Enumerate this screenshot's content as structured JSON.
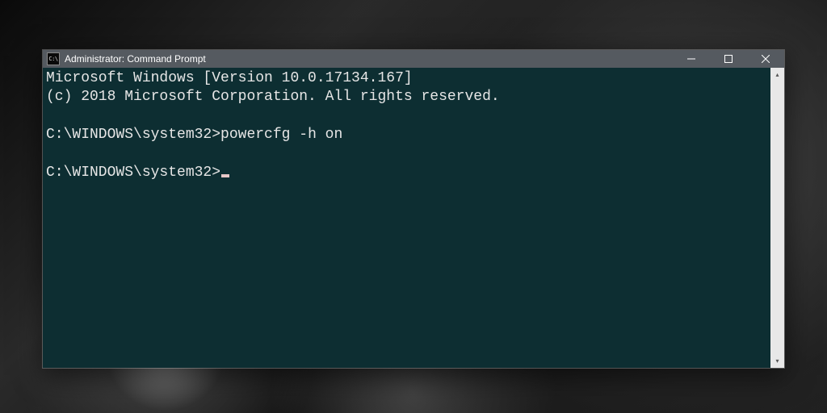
{
  "window": {
    "title": "Administrator: Command Prompt",
    "icon_label": "C:\\"
  },
  "console": {
    "banner1": "Microsoft Windows [Version 10.0.17134.167]",
    "banner2": "(c) 2018 Microsoft Corporation. All rights reserved.",
    "prompt1_path": "C:\\WINDOWS\\system32>",
    "prompt1_cmd": "powercfg -h on",
    "prompt2_path": "C:\\WINDOWS\\system32>"
  },
  "colors": {
    "console_bg": "#0d2e32",
    "console_fg": "#e6e6e6",
    "titlebar_bg": "#555a60"
  }
}
